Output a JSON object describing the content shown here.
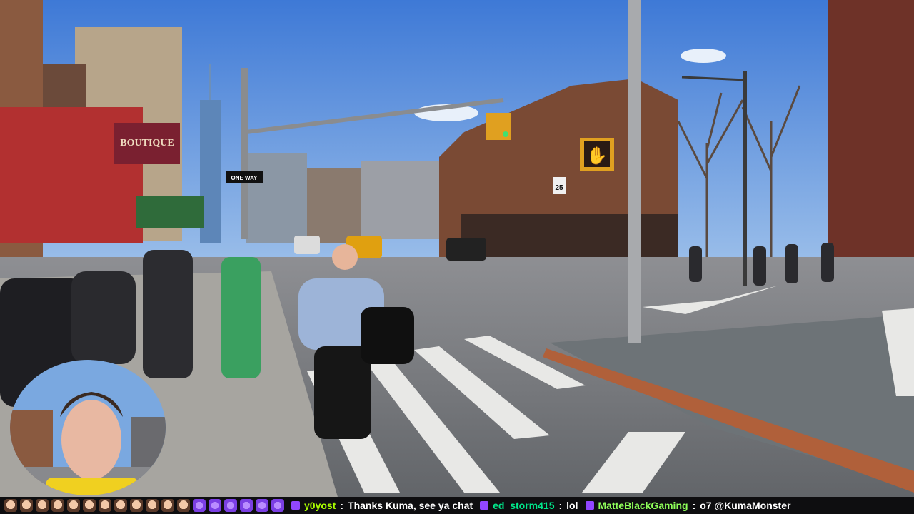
{
  "scene": {
    "signs": {
      "store_sign": "BOUTIQUE",
      "one_way": "ONE WAY",
      "speed_limit": "25"
    }
  },
  "chat": {
    "emotes": [
      "face",
      "face",
      "face",
      "face",
      "face",
      "face",
      "face",
      "face",
      "face",
      "face",
      "face",
      "face",
      "purple",
      "purple",
      "purple",
      "purple",
      "purple",
      "purple"
    ],
    "messages": [
      {
        "user": "y0yost",
        "sep": ":",
        "text": "Thanks Kuma, see ya chat",
        "color": "#aaff00"
      },
      {
        "user": "ed_storm415",
        "sep": ":",
        "text": "lol",
        "color": "#00e68a"
      },
      {
        "user": "MatteBlackGaming",
        "sep": ":",
        "text": "o7 @KumaMonster",
        "color": "#8fff5a"
      }
    ]
  }
}
